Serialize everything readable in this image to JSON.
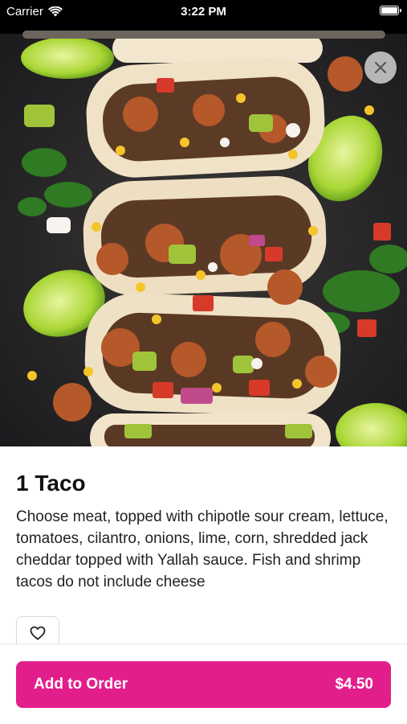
{
  "status_bar": {
    "carrier": "Carrier",
    "time": "3:22 PM"
  },
  "icons": {
    "wifi": "wifi-icon",
    "battery": "battery-icon",
    "close": "close-icon",
    "favorite": "heart-icon"
  },
  "item": {
    "title": "1 Taco",
    "description": "Choose meat, topped with chipotle sour cream, lettuce, tomatoes, cilantro, onions, lime, corn, shredded jack cheddar topped with Yallah sauce. Fish and shrimp tacos do not include cheese"
  },
  "order_button": {
    "label": "Add to Order",
    "price": "$4.50"
  },
  "colors": {
    "accent": "#e21e8c",
    "background": "#ffffff"
  }
}
